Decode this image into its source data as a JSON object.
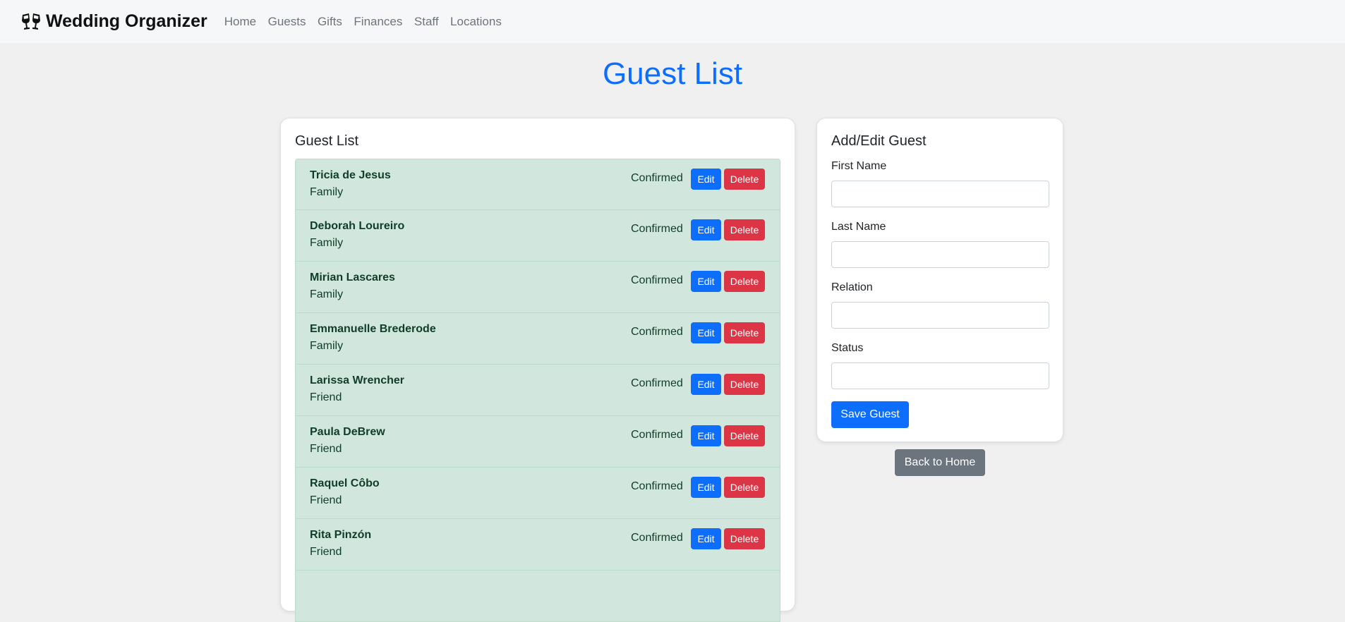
{
  "navbar": {
    "brand": "Wedding Organizer",
    "brand_icon": "clinking-glasses-icon",
    "links": [
      "Home",
      "Guests",
      "Gifts",
      "Finances",
      "Staff",
      "Locations"
    ]
  },
  "page": {
    "title": "Guest List"
  },
  "guest_list": {
    "title": "Guest List",
    "edit_label": "Edit",
    "delete_label": "Delete",
    "guests": [
      {
        "name": "Tricia de Jesus",
        "relation": "Family",
        "status": "Confirmed"
      },
      {
        "name": "Deborah Loureiro",
        "relation": "Family",
        "status": "Confirmed"
      },
      {
        "name": "Mirian Lascares",
        "relation": "Family",
        "status": "Confirmed"
      },
      {
        "name": "Emmanuelle Brederode",
        "relation": "Family",
        "status": "Confirmed"
      },
      {
        "name": "Larissa Wrencher",
        "relation": "Friend",
        "status": "Confirmed"
      },
      {
        "name": "Paula DeBrew",
        "relation": "Friend",
        "status": "Confirmed"
      },
      {
        "name": "Raquel Côbo",
        "relation": "Friend",
        "status": "Confirmed"
      },
      {
        "name": "Rita Pinzón",
        "relation": "Friend",
        "status": "Confirmed"
      }
    ]
  },
  "form": {
    "title": "Add/Edit Guest",
    "first_name_label": "First Name",
    "first_name_value": "",
    "last_name_label": "Last Name",
    "last_name_value": "",
    "relation_label": "Relation",
    "relation_value": "",
    "status_label": "Status",
    "status_value": "",
    "save_label": "Save Guest"
  },
  "back_label": "Back to Home",
  "colors": {
    "primary": "#0d6efd",
    "danger": "#dc3545",
    "secondary": "#6c757d",
    "success_bg": "#d1e7dd"
  }
}
